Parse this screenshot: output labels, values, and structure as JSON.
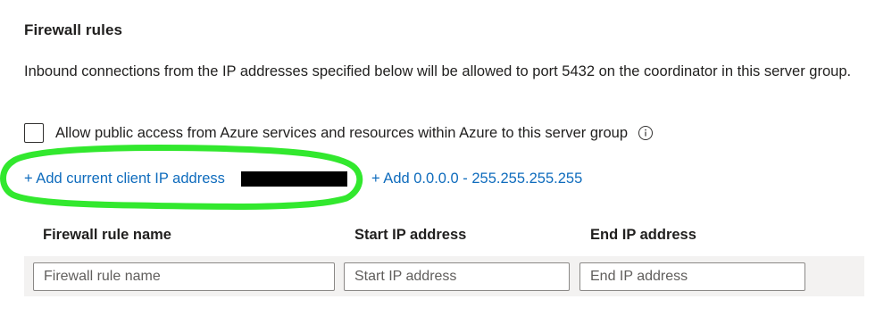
{
  "firewall": {
    "title": "Firewall rules",
    "description": "Inbound connections from the IP addresses specified below will be allowed to port 5432 on the coordinator in this server group.",
    "allow_azure_label": "Allow public access from Azure services and resources within Azure to this server group",
    "allow_azure_checked": false,
    "info_icon": "info-icon",
    "add_client_ip_label": "+ Add current client IP address",
    "add_all_ip_label": "+ Add 0.0.0.0 - 255.255.255.255",
    "link_color": "#0f6cbd",
    "highlight_color": "#32e82e"
  },
  "grid": {
    "columns": [
      "Firewall rule name",
      "Start IP address",
      "End IP address"
    ],
    "new_row": {
      "name_placeholder": "Firewall rule name",
      "start_placeholder": "Start IP address",
      "end_placeholder": "End IP address",
      "name_value": "",
      "start_value": "",
      "end_value": ""
    }
  }
}
